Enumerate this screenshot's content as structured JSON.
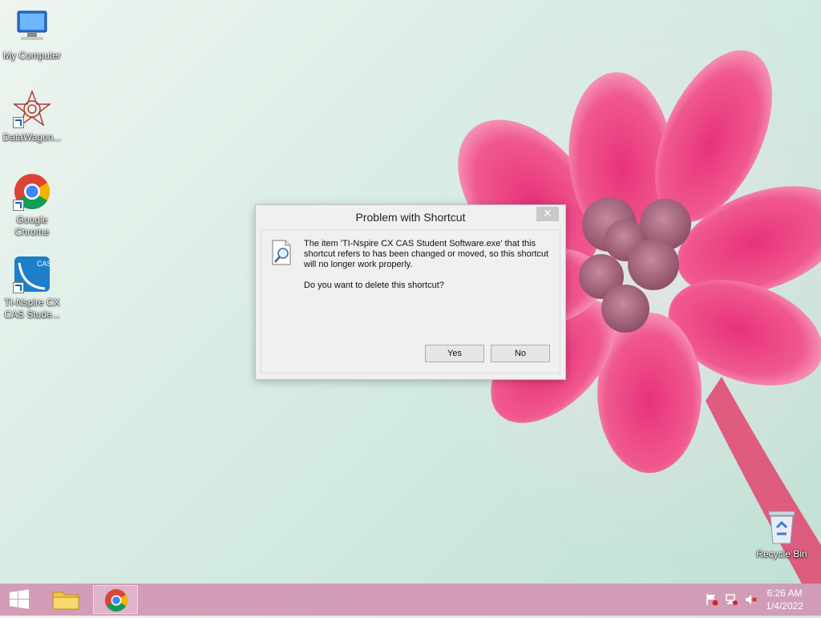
{
  "desktop": {
    "icons": [
      {
        "label": "My Computer"
      },
      {
        "label": "DataWagon..."
      },
      {
        "label": "Google Chrome"
      },
      {
        "label": "TI-Nspire CX CAS Stude..."
      },
      {
        "label": "Recycle Bin"
      }
    ]
  },
  "dialog": {
    "title": "Problem with Shortcut",
    "close_label": "×",
    "message": "The item 'TI-Nspire CX CAS Student Software.exe' that this shortcut refers to has been changed or moved, so this shortcut will no longer work properly.",
    "question": "Do you want to delete this shortcut?",
    "yes_label": "Yes",
    "no_label": "No"
  },
  "taskbar": {
    "time": "6:26 AM",
    "date": "1/4/2022"
  },
  "colors": {
    "taskbar": "#d296b4",
    "accent": "#1a5fb4"
  }
}
